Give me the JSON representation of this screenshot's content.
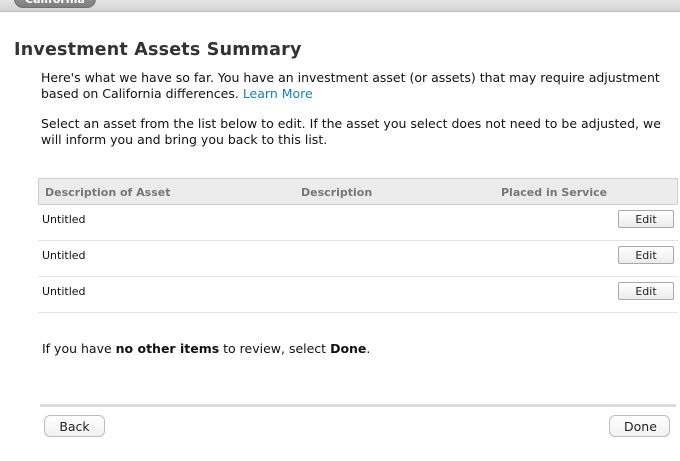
{
  "header": {
    "state_tab": "California"
  },
  "page": {
    "title": "Investment Assets Summary",
    "intro_text": "Here's what we have so far. You have an investment asset (or assets) that may require adjustment based on California differences.",
    "learn_more_label": "Learn More",
    "instructions": "Select an asset from the list below to edit. If the asset you select does not need to be adjusted, we will inform you and bring you back to this list."
  },
  "table": {
    "columns": [
      "Description of Asset",
      "Description",
      "Placed in Service"
    ],
    "rows": [
      {
        "asset": "Untitled",
        "description": "",
        "placed_in_service": "",
        "action": "Edit"
      },
      {
        "asset": "Untitled",
        "description": "",
        "placed_in_service": "",
        "action": "Edit"
      },
      {
        "asset": "Untitled",
        "description": "",
        "placed_in_service": "",
        "action": "Edit"
      }
    ]
  },
  "review": {
    "prefix": "If you have ",
    "bold_phrase": "no other items",
    "middle": " to review, select ",
    "bold_done": "Done",
    "suffix": "."
  },
  "footer": {
    "back_label": "Back",
    "done_label": "Done"
  }
}
